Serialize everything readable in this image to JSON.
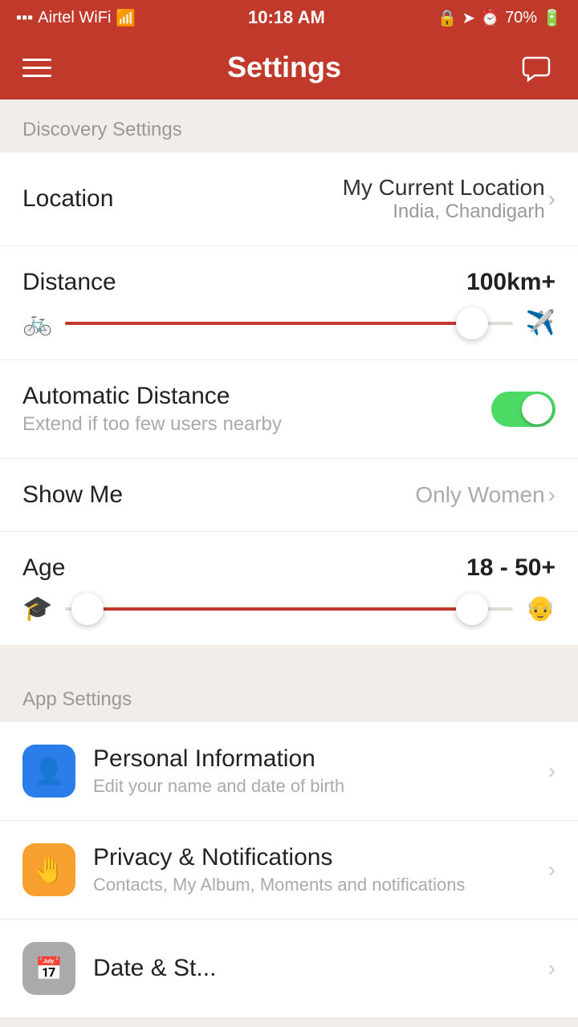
{
  "statusBar": {
    "carrier": "Airtel WiFi",
    "time": "10:18 AM",
    "battery": "70%"
  },
  "header": {
    "title": "Settings",
    "hamburgerLabel": "menu",
    "chatLabel": "chat"
  },
  "discoverySection": {
    "label": "Discovery Settings"
  },
  "location": {
    "label": "Location",
    "valueMain": "My Current Location",
    "valueSub": "India, Chandigarh"
  },
  "distance": {
    "label": "Distance",
    "value": "100km+",
    "sliderFillPercent": 93,
    "thumbPositionPercent": 91,
    "iconLeft": "🚲",
    "iconRight": "✈"
  },
  "automaticDistance": {
    "title": "Automatic Distance",
    "subtitle": "Extend if too few users nearby",
    "toggleOn": true
  },
  "showMe": {
    "label": "Show Me",
    "value": "Only Women",
    "hasChevron": true
  },
  "age": {
    "label": "Age",
    "value": "18 - 50+",
    "leftThumbPercent": 5,
    "rightThumbPercent": 91,
    "iconLeft": "🎓",
    "iconRight": "👴"
  },
  "appSection": {
    "label": "App Settings"
  },
  "appSettings": [
    {
      "id": "personal-info",
      "iconColor": "blue",
      "iconSymbol": "👤",
      "title": "Personal Information",
      "subtitle": "Edit your name and date of birth"
    },
    {
      "id": "privacy-notifications",
      "iconColor": "orange",
      "iconSymbol": "🤚",
      "title": "Privacy & Notifications",
      "subtitle": "Contacts, My Album, Moments and notifications"
    },
    {
      "id": "date-settings",
      "iconColor": "gray",
      "iconSymbol": "📅",
      "title": "Date & St...",
      "subtitle": ""
    }
  ],
  "chevron": "›"
}
